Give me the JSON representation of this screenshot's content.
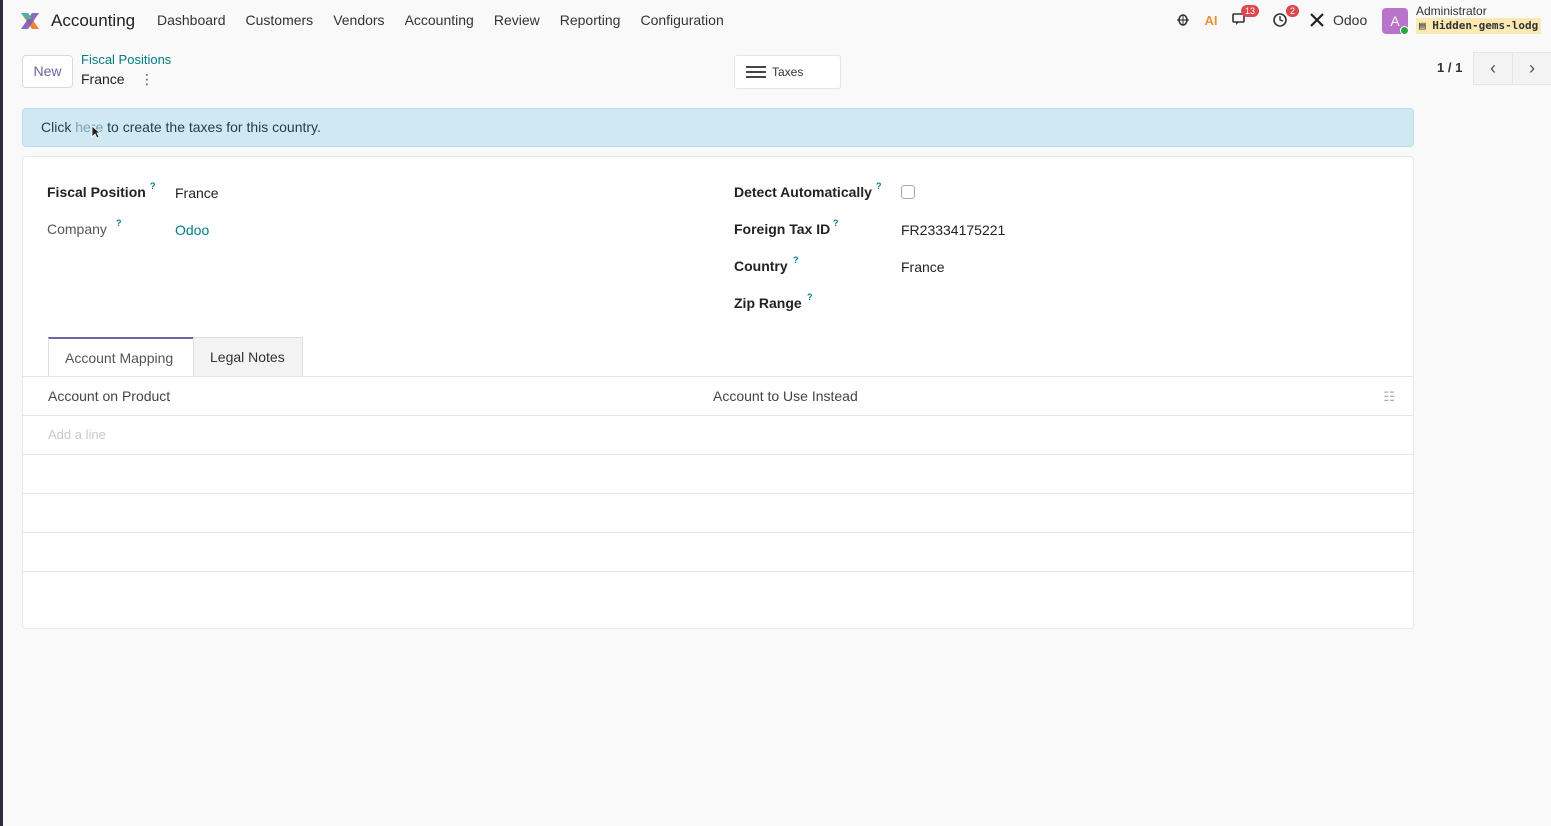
{
  "navbar": {
    "app_name": "Accounting",
    "menu": [
      "Dashboard",
      "Customers",
      "Vendors",
      "Accounting",
      "Review",
      "Reporting",
      "Configuration"
    ],
    "messages_badge": "13",
    "activities_badge": "2",
    "company": "Odoo",
    "avatar_letter": "A",
    "user": "Administrator",
    "database": "Hidden-gems-lodg"
  },
  "control": {
    "new_label": "New",
    "breadcrumb": "Fiscal Positions",
    "record_name": "France",
    "taxes_label": "Taxes",
    "pager": "1 / 1",
    "prev": "‹",
    "next": "›"
  },
  "alert": {
    "before": "Click ",
    "link": "here",
    "after": " to create the taxes for this country."
  },
  "form": {
    "fiscal_position_label": "Fiscal Position",
    "fiscal_position_value": "France",
    "company_label": "Company",
    "company_value": "Odoo",
    "detect_label": "Detect Automatically",
    "detect_checked": false,
    "foreign_tax_label": "Foreign Tax ID",
    "foreign_tax_value": "FR23334175221",
    "country_label": "Country",
    "country_value": "France",
    "zip_label": "Zip Range",
    "help_mark": "?"
  },
  "tabs": [
    "Account Mapping",
    "Legal Notes"
  ],
  "list": {
    "col1": "Account on Product",
    "col2": "Account to Use Instead",
    "add_line": "Add a line"
  },
  "colors": {
    "primary": "#71639e",
    "link": "#017e84",
    "alert_bg": "#cfe8f1",
    "badge": "#e0464e"
  }
}
